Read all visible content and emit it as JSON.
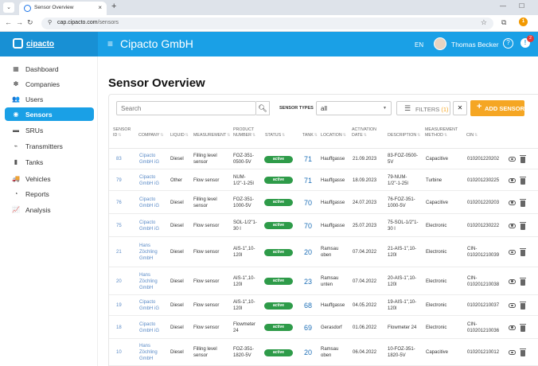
{
  "browser": {
    "tab_title": "Sensor Overview",
    "url_host": "cap.cipacto.com",
    "url_path": "/sensors",
    "extension_badge": "1"
  },
  "header": {
    "logo_text": "cipacto",
    "company": "Cipacto GmbH",
    "language": "EN",
    "user_name": "Thomas Becker",
    "notification_count": "2"
  },
  "sidebar": {
    "items": [
      {
        "label": "Dashboard",
        "icon": "dashboard-icon",
        "glyph": "▦"
      },
      {
        "label": "Companies",
        "icon": "companies-icon",
        "glyph": "✽"
      },
      {
        "label": "Users",
        "icon": "users-icon",
        "glyph": "👥"
      },
      {
        "label": "Sensors",
        "icon": "sensor-icon",
        "glyph": "◉",
        "active": true
      },
      {
        "label": "SRUs",
        "icon": "sru-icon",
        "glyph": "▬"
      },
      {
        "label": "Transmitters",
        "icon": "transmitter-icon",
        "glyph": "⌁"
      },
      {
        "label": "Tanks",
        "icon": "tank-icon",
        "glyph": "▮"
      },
      {
        "label": "Vehicles",
        "icon": "vehicle-icon",
        "glyph": "🚚"
      },
      {
        "label": "Reports",
        "icon": "reports-icon",
        "glyph": "◔"
      },
      {
        "label": "Analysis",
        "icon": "analysis-icon",
        "glyph": "📈"
      }
    ]
  },
  "page": {
    "title": "Sensor Overview"
  },
  "toolbar": {
    "search_placeholder": "Search",
    "types_label": "SENSOR TYPES",
    "types_value": "all",
    "filters_label": "FILTERS",
    "filters_count": "(1)",
    "clear_label": "✕",
    "add_label": "ADD SENSOR"
  },
  "table": {
    "headers": {
      "sensor_id": [
        "SENSOR",
        "ID"
      ],
      "company": [
        "COMPANY"
      ],
      "liquid": [
        "LIQUID"
      ],
      "measurement": [
        "MEASUREMENT"
      ],
      "product_number": [
        "PRODUCT",
        "NUMBER"
      ],
      "status": [
        "STATUS"
      ],
      "tank": [
        "TANK"
      ],
      "location": [
        "LOCATION"
      ],
      "activation_date": [
        "ACTIVATION",
        "DATE"
      ],
      "description": [
        "DESCRIPTION"
      ],
      "measurement_method": [
        "MEASUREMENT",
        "METHOD"
      ],
      "cin": [
        "CIN"
      ]
    },
    "rows": [
      {
        "id": "83",
        "company": [
          "Cipacto",
          "GmbH iG"
        ],
        "liquid": "Diesel",
        "measurement": [
          "Filling level",
          "sensor"
        ],
        "product": [
          "FOZ-351-",
          "0500-5V"
        ],
        "status": "active",
        "tank": "71",
        "location": [
          "Hauffgasse"
        ],
        "date": "21.09.2023",
        "description": [
          "83-FOZ-0500-",
          "5V"
        ],
        "method": "Capacitive",
        "cin": [
          "010201220202"
        ]
      },
      {
        "id": "79",
        "company": [
          "Cipacto",
          "GmbH iG"
        ],
        "liquid": "Other",
        "measurement": [
          "Flow sensor"
        ],
        "product": [
          "NUM-",
          "1/2\"-1-25l"
        ],
        "status": "active",
        "tank": "71",
        "location": [
          "Hauffgasse"
        ],
        "date": "18.09.2023",
        "description": [
          "79-NUM-",
          "1/2\"-1-25l"
        ],
        "method": "Turbine",
        "cin": [
          "010201230225"
        ]
      },
      {
        "id": "76",
        "company": [
          "Cipacto",
          "GmbH iG"
        ],
        "liquid": "Diesel",
        "measurement": [
          "Filling level",
          "sensor"
        ],
        "product": [
          "FOZ-351-",
          "1000-5V"
        ],
        "status": "active",
        "tank": "70",
        "location": [
          "Hauffgasse"
        ],
        "date": "24.07.2023",
        "description": [
          "76-FOZ-351-",
          "1000-5V"
        ],
        "method": "Capacitive",
        "cin": [
          "010201220203"
        ]
      },
      {
        "id": "75",
        "company": [
          "Cipacto",
          "GmbH iG"
        ],
        "liquid": "Diesel",
        "measurement": [
          "Flow sensor"
        ],
        "product": [
          "SOL-1/2\"1-",
          "30 l"
        ],
        "status": "active",
        "tank": "70",
        "location": [
          "Hauffgasse"
        ],
        "date": "25.07.2023",
        "description": [
          "75-SOL-1/2\"1-",
          "30 l"
        ],
        "method": "Electronic",
        "cin": [
          "010201230222"
        ]
      },
      {
        "id": "21",
        "company": [
          "Hans",
          "Zöchling",
          "GmbH"
        ],
        "liquid": "Diesel",
        "measurement": [
          "Flow sensor"
        ],
        "product": [
          "AIS-1\",10-",
          "120l"
        ],
        "status": "active",
        "tank": "20",
        "location": [
          "Ramsau",
          "oben"
        ],
        "date": "07.04.2022",
        "description": [
          "21-AIS-1\",10-",
          "120l"
        ],
        "method": "Electronic",
        "cin": [
          "CIN-",
          "010201210039"
        ]
      },
      {
        "id": "20",
        "company": [
          "Hans",
          "Zöchling",
          "GmbH"
        ],
        "liquid": "Diesel",
        "measurement": [
          "Flow sensor"
        ],
        "product": [
          "AIS-1\",10-",
          "120l"
        ],
        "status": "active",
        "tank": "23",
        "location": [
          "Ramsau",
          "unten"
        ],
        "date": "07.04.2022",
        "description": [
          "20-AIS-1\",10-",
          "120l"
        ],
        "method": "Electronic",
        "cin": [
          "CIN-",
          "010201210038"
        ]
      },
      {
        "id": "19",
        "company": [
          "Cipacto",
          "GmbH iG"
        ],
        "liquid": "Diesel",
        "measurement": [
          "Flow sensor"
        ],
        "product": [
          "AIS-1\",10-",
          "120l"
        ],
        "status": "active",
        "tank": "68",
        "location": [
          "Hauffgasse"
        ],
        "date": "04.05.2022",
        "description": [
          "19-AIS-1\",10-",
          "120l"
        ],
        "method": "Electronic",
        "cin": [
          "010201210037"
        ]
      },
      {
        "id": "18",
        "company": [
          "Cipacto",
          "GmbH iG"
        ],
        "liquid": "Diesel",
        "measurement": [
          "Flow sensor"
        ],
        "product": [
          "Flowmeter",
          "24"
        ],
        "status": "active",
        "tank": "69",
        "location": [
          "Gerasdorf"
        ],
        "date": "01.06.2022",
        "description": [
          "Flowmeter 24"
        ],
        "method": "Electronic",
        "cin": [
          "CIN-",
          "010201210036"
        ]
      },
      {
        "id": "10",
        "company": [
          "Hans",
          "Zöchling",
          "GmbH"
        ],
        "liquid": "Diesel",
        "measurement": [
          "Filling level",
          "sensor"
        ],
        "product": [
          "FOZ-351-",
          "1820-5V"
        ],
        "status": "active",
        "tank": "20",
        "location": [
          "Ramsau",
          "oben"
        ],
        "date": "06.04.2022",
        "description": [
          "10-FOZ-351-",
          "1820-5V"
        ],
        "method": "Capacitive",
        "cin": [
          "010201210012"
        ]
      }
    ]
  }
}
